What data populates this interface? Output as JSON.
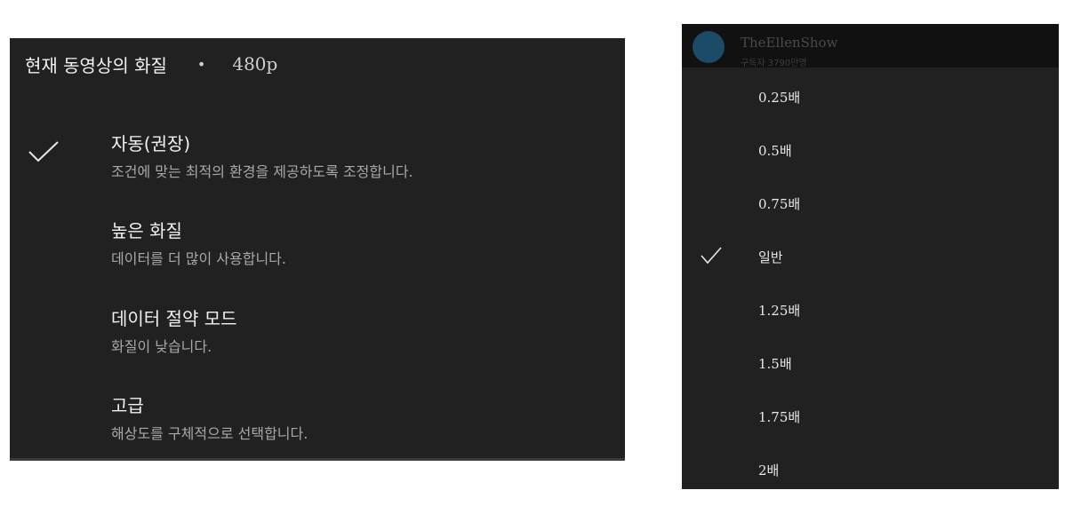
{
  "quality": {
    "header": {
      "title": "현재 동영상의 화질",
      "separator": "•",
      "current_resolution": "480p"
    },
    "options": [
      {
        "title": "자동(권장)",
        "description": "조건에 맞는 최적의 환경을 제공하도록 조정합니다.",
        "selected": true
      },
      {
        "title": "높은 화질",
        "description": "데이터를 더 많이 사용합니다.",
        "selected": false
      },
      {
        "title": "데이터 절약 모드",
        "description": "화질이 낮습니다.",
        "selected": false
      },
      {
        "title": "고급",
        "description": "해상도를 구체적으로 선택합니다.",
        "selected": false
      }
    ]
  },
  "speed": {
    "channel": {
      "name": "TheEllenShow",
      "subscribers": "구독자 3790만명"
    },
    "options": [
      {
        "label": "0.25배",
        "selected": false
      },
      {
        "label": "0.5배",
        "selected": false
      },
      {
        "label": "0.75배",
        "selected": false
      },
      {
        "label": "일반",
        "selected": true
      },
      {
        "label": "1.25배",
        "selected": false
      },
      {
        "label": "1.5배",
        "selected": false
      },
      {
        "label": "1.75배",
        "selected": false
      },
      {
        "label": "2배",
        "selected": false
      }
    ]
  },
  "colors": {
    "panel_bg": "#212121",
    "channel_bar_bg": "#111111",
    "text_primary": "#f1f1f1",
    "text_secondary": "#a8a8a8",
    "avatar": "#1b4b66"
  },
  "icons": {
    "selected": "check-icon"
  }
}
